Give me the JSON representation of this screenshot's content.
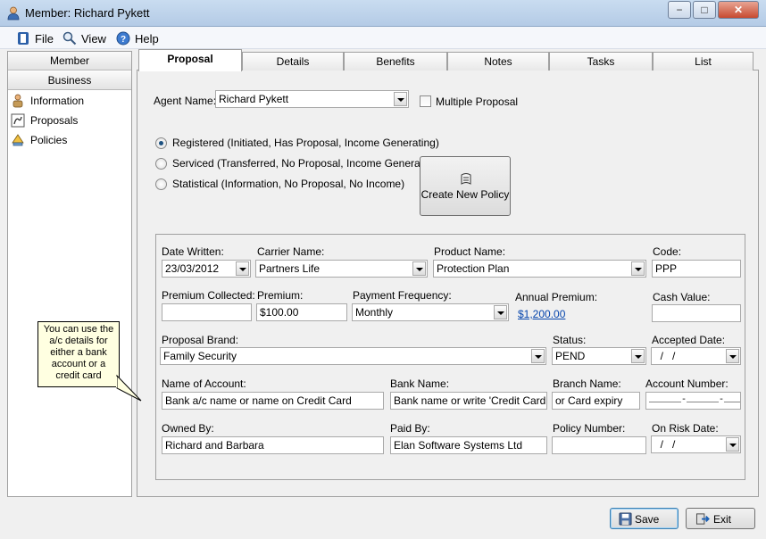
{
  "window": {
    "title": "Member: Richard Pykett",
    "min_symbol": "−",
    "max_symbol": "□",
    "close_symbol": "✕"
  },
  "menu": {
    "file": "File",
    "view": "View",
    "help": "Help"
  },
  "sidebar": {
    "member_header": "Member",
    "business_header": "Business",
    "items": [
      {
        "label": "Information",
        "icon": "information-icon"
      },
      {
        "label": "Proposals",
        "icon": "proposals-icon"
      },
      {
        "label": "Policies",
        "icon": "policies-icon"
      }
    ]
  },
  "tabs": [
    {
      "label": "Proposal",
      "active": true
    },
    {
      "label": "Details"
    },
    {
      "label": "Benefits"
    },
    {
      "label": "Notes"
    },
    {
      "label": "Tasks"
    },
    {
      "label": "List"
    }
  ],
  "proposal": {
    "agent_name_label": "Agent Name:",
    "agent_name_value": "Richard Pykett",
    "multiple_proposal_label": "Multiple Proposal",
    "multiple_proposal_checked": false,
    "radio_options": [
      {
        "label": "Registered (Initiated, Has Proposal, Income Generating)",
        "selected": true
      },
      {
        "label": "Serviced (Transferred, No Proposal, Income Generating)",
        "selected": false
      },
      {
        "label": "Statistical (Information, No Proposal, No Income)",
        "selected": false
      }
    ],
    "create_policy_button": "Create New Policy",
    "date_written_label": "Date Written:",
    "date_written_value": "23/03/2012",
    "carrier_name_label": "Carrier Name:",
    "carrier_name_value": "Partners Life",
    "product_name_label": "Product Name:",
    "product_name_value": "Protection Plan",
    "code_label": "Code:",
    "code_value": "PPP",
    "premium_collected_label": "Premium Collected:",
    "premium_collected_value": "",
    "premium_label": "Premium:",
    "premium_value": "$100.00",
    "payment_frequency_label": "Payment Frequency:",
    "payment_frequency_value": "Monthly",
    "annual_premium_label": "Annual Premium:",
    "annual_premium_value": "$1,200.00",
    "cash_value_label": "Cash Value:",
    "cash_value_value": "",
    "proposal_brand_label": "Proposal Brand:",
    "proposal_brand_value": "Family Security",
    "status_label": "Status:",
    "status_value": "PEND",
    "accepted_date_label": "Accepted Date:",
    "accepted_date_value": "  /   /",
    "name_of_account_label": "Name of Account:",
    "name_of_account_value": "Bank a/c name or name on Credit Card",
    "bank_name_label": "Bank Name:",
    "bank_name_value": "Bank name or write 'Credit Card'",
    "branch_name_label": "Branch Name:",
    "branch_name_value": "or Card expiry",
    "account_number_label": "Account Number:",
    "account_number_value": "______-______-___",
    "owned_by_label": "Owned By:",
    "owned_by_value": "Richard and Barbara",
    "paid_by_label": "Paid By:",
    "paid_by_value": "Elan Software Systems Ltd",
    "policy_number_label": "Policy Number:",
    "policy_number_value": "",
    "on_risk_date_label": "On Risk Date:",
    "on_risk_date_value": "  /   /"
  },
  "callout": "You can use the a/c details for either a bank account or a credit card",
  "buttons": {
    "save": "Save",
    "exit": "Exit"
  }
}
